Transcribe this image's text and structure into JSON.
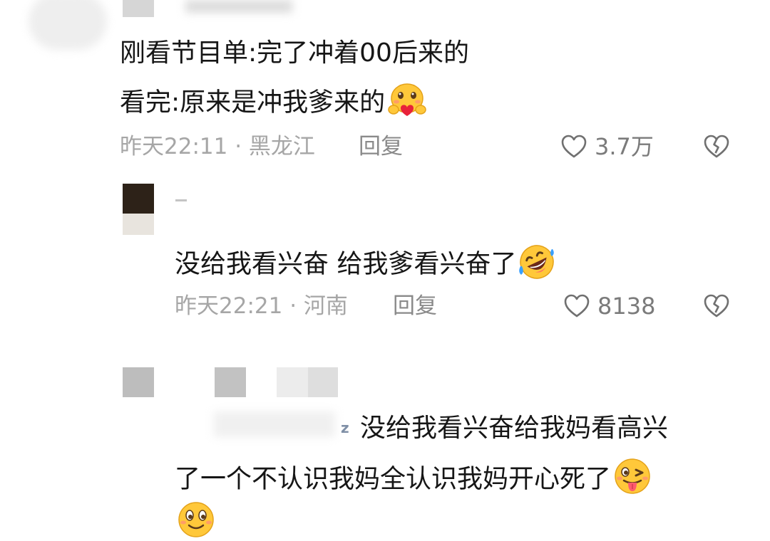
{
  "comments": [
    {
      "line1": "刚看节目单:完了冲着00后来的",
      "line2": "看完:原来是冲我爹来的",
      "emoji": "hugging-face",
      "time": "昨天22:11",
      "location": "黑龙江",
      "reply": "回复",
      "likes": "3.7万"
    },
    {
      "line1": "没给我看兴奋 给我爹看兴奋了",
      "emoji": "rolling-on-floor-laughing",
      "time": "昨天22:21",
      "location": "河南",
      "reply": "回复",
      "likes": "8138"
    },
    {
      "line1": "没给我看兴奋给我妈看高兴",
      "line2": "了一个不认识我妈全认识我妈开心死了",
      "emoji": "winking-tongue-face",
      "emoji2": "smiling-face",
      "mark": "z"
    }
  ],
  "separator": " · "
}
